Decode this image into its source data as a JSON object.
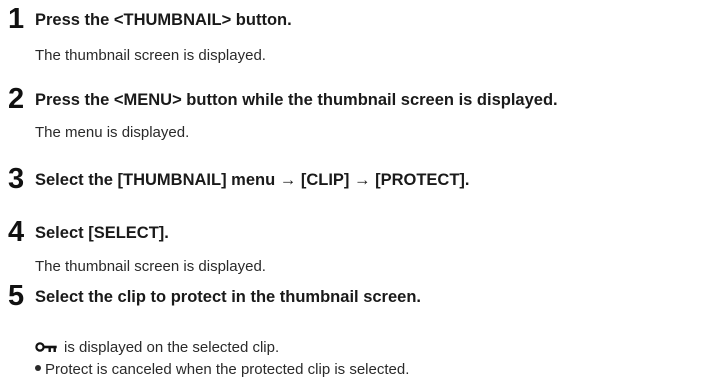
{
  "steps": [
    {
      "number": "1",
      "title": "Press the <THUMBNAIL> button.",
      "description": "The thumbnail screen is displayed."
    },
    {
      "number": "2",
      "title": "Press the <MENU> button while the thumbnail screen is displayed.",
      "description": "The menu is displayed."
    },
    {
      "number": "3",
      "title": "Select the [THUMBNAIL] menu → [CLIP] → [PROTECT]."
    },
    {
      "number": "4",
      "title": "Select [SELECT].",
      "description": "The thumbnail screen is displayed."
    },
    {
      "number": "5",
      "title": "Select the clip to protect in the thumbnail screen.",
      "description": "is displayed on the selected clip.",
      "note": "Protect is canceled when the protected clip is selected.",
      "icon": "key-icon"
    }
  ]
}
